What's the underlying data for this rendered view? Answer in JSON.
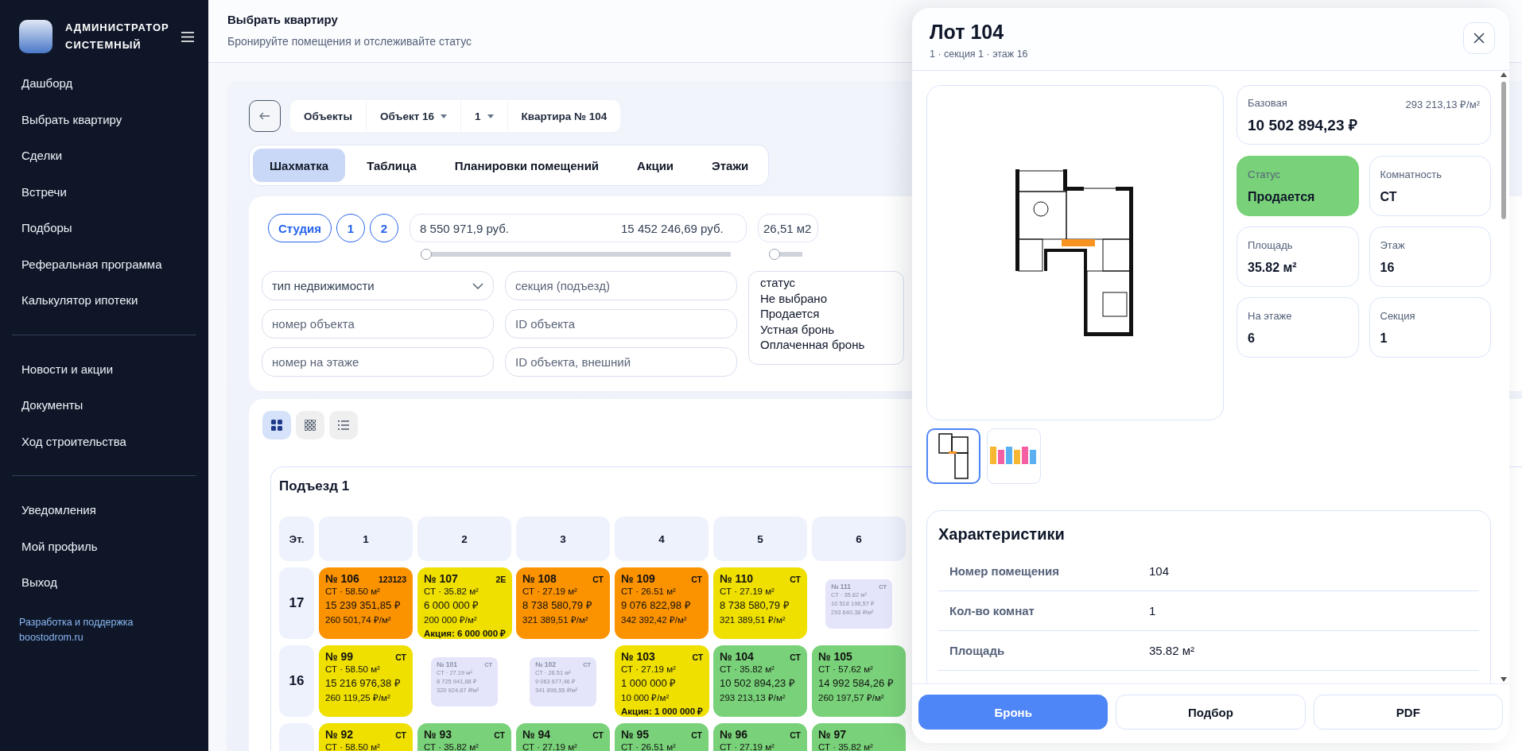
{
  "sidebar": {
    "user_name": "АДМИНИСТРАТОР СИСТЕМНЫЙ",
    "nav_groups": [
      [
        "Дашборд",
        "Выбрать квартиру",
        "Сделки",
        "Встречи",
        "Подборы",
        "Реферальная программа",
        "Калькулятор ипотеки"
      ],
      [
        "Новости и акции",
        "Документы",
        "Ход строительства"
      ],
      [
        "Уведомления",
        "Мой профиль",
        "Выход"
      ]
    ],
    "footer_link": "Разработка и поддержка boostodrom.ru"
  },
  "header": {
    "title": "Выбрать квартиру",
    "subtitle": "Бронируйте помещения и отслеживайте статус"
  },
  "breadcrumbs": [
    {
      "label": "Объекты",
      "dropdown": false
    },
    {
      "label": "Объект 16",
      "dropdown": true
    },
    {
      "label": "1",
      "dropdown": true
    },
    {
      "label": "Квартира № 104",
      "dropdown": false
    }
  ],
  "tabs": [
    {
      "label": "Шахматка",
      "selected": true
    },
    {
      "label": "Таблица",
      "selected": false
    },
    {
      "label": "Планировки помещений",
      "selected": false
    },
    {
      "label": "Акции",
      "selected": false
    },
    {
      "label": "Этажи",
      "selected": false
    }
  ],
  "filters": {
    "room_chips": [
      "Студия",
      "1",
      "2"
    ],
    "price_range": {
      "min": "8 550 971,9 руб.",
      "max": "15 452 246,69 руб.",
      "level": 0
    },
    "area_range": {
      "min": "26,51 м2",
      "level": 0
    },
    "field_columns": [
      [
        {
          "kind": "select",
          "placeholder": "тип недвижимости"
        },
        {
          "kind": "text",
          "placeholder": "номер объекта"
        },
        {
          "kind": "text",
          "placeholder": "номер на этаже"
        }
      ],
      [
        {
          "kind": "text",
          "placeholder": "секция (подъезд)"
        },
        {
          "kind": "text",
          "placeholder": "ID объекта"
        },
        {
          "kind": "text",
          "placeholder": "ID объекта, внешний"
        }
      ]
    ],
    "status_options": [
      "статус",
      "Не выбрано",
      "Продается",
      "Устная бронь",
      "Оплаченная бронь"
    ]
  },
  "view_modes": [
    {
      "kind": "tiles",
      "selected": true
    },
    {
      "kind": "grid",
      "selected": false
    },
    {
      "kind": "list",
      "selected": false
    }
  ],
  "section": {
    "title": "Подъезд 1",
    "floor_label": "Эт.",
    "columns": [
      "1",
      "2",
      "3",
      "4",
      "5",
      "6"
    ],
    "rows": [
      {
        "floor": "17",
        "cells": [
          {
            "kind": "lot",
            "color": "#fb9200",
            "number": "№ 106",
            "badge": "123123",
            "area": "СТ · 58.50 м²",
            "price": "15 239 351,85 ₽",
            "per_m2": "260 501,74 ₽/м²"
          },
          {
            "kind": "lot",
            "color": "#efe000",
            "number": "№ 107",
            "badge": "2Е",
            "area": "СТ · 35.82 м²",
            "price": "6 000 000 ₽",
            "per_m2": "200 000 ₽/м²",
            "promo": "Акция: 6 000 000 ₽"
          },
          {
            "kind": "lot",
            "color": "#fb9200",
            "number": "№ 108",
            "badge": "СТ",
            "area": "СТ · 27.19 м²",
            "price": "8 738 580,79 ₽",
            "per_m2": "321 389,51 ₽/м²"
          },
          {
            "kind": "lot",
            "color": "#fb9200",
            "number": "№ 109",
            "badge": "СТ",
            "area": "СТ · 26.51 м²",
            "price": "9 076 822,98 ₽",
            "per_m2": "342 392,42 ₽/м²"
          },
          {
            "kind": "lot",
            "color": "#efe000",
            "number": "№ 110",
            "badge": "СТ",
            "area": "СТ · 27.19 м²",
            "price": "8 738 580,79 ₽",
            "per_m2": "321 389,51 ₽/м²"
          },
          {
            "kind": "ghost",
            "color": "#e4e4fb",
            "number": "№ 111",
            "badge": "СТ",
            "area": "СТ · 35.82 м²",
            "price": "10 518 198,57 ₽",
            "per_m2": "293 640,38 ₽/м²"
          }
        ]
      },
      {
        "floor": "16",
        "cells": [
          {
            "kind": "lot",
            "color": "#efe000",
            "number": "№ 99",
            "badge": "СТ",
            "area": "СТ · 58.50 м²",
            "price": "15 216 976,38 ₽",
            "per_m2": "260 119,25 ₽/м²"
          },
          {
            "kind": "ghost",
            "color": "#e4e4fb",
            "number": "№ 101",
            "badge": "СТ",
            "area": "СТ · 27.19 м²",
            "price": "8 725 941,88 ₽",
            "per_m2": "320 924,67 ₽/м²"
          },
          {
            "kind": "ghost",
            "color": "#e4e4fb",
            "number": "№ 102",
            "badge": "СТ",
            "area": "СТ · 26.51 м²",
            "price": "9 063 677,46 ₽",
            "per_m2": "341 896,55 ₽/м²"
          },
          {
            "kind": "lot",
            "color": "#efe000",
            "number": "№ 103",
            "badge": "СТ",
            "area": "СТ · 27.19 м²",
            "price": "1 000 000 ₽",
            "per_m2": "10 000 ₽/м²",
            "promo": "Акция: 1 000 000 ₽"
          },
          {
            "kind": "lot",
            "color": "#79d279",
            "number": "№ 104",
            "badge": "СТ",
            "area": "СТ · 35.82 м²",
            "price": "10 502 894,23 ₽",
            "per_m2": "293 213,13 ₽/м²"
          },
          {
            "kind": "lot",
            "color": "#79d279",
            "number": "№ 105",
            "area": "СТ · 57.62 м²",
            "price": "14 992 584,26 ₽",
            "per_m2": "260 197,57 ₽/м²"
          }
        ]
      },
      {
        "cells": [
          {
            "kind": "lot",
            "color": "#efe000",
            "number": "№ 92",
            "badge": "СТ",
            "area": "СТ · 58.50 м²"
          },
          {
            "kind": "lot",
            "color": "#79d279",
            "number": "№ 93",
            "badge": "СТ",
            "area": "СТ · 35.82 м²"
          },
          {
            "kind": "lot",
            "color": "#79d279",
            "number": "№ 94",
            "badge": "СТ",
            "area": "СТ · 27.19 м²"
          },
          {
            "kind": "lot",
            "color": "#79d279",
            "number": "№ 95",
            "badge": "СТ",
            "area": "СТ · 26.51 м²"
          },
          {
            "kind": "lot",
            "color": "#79d279",
            "number": "№ 96",
            "badge": "СТ",
            "area": "СТ · 27.19 м²"
          },
          {
            "kind": "lot",
            "color": "#79d279",
            "number": "№ 97",
            "area": "СТ · 35.82 м²"
          }
        ]
      }
    ]
  },
  "lot_panel": {
    "title": "Лот 104",
    "subtitle": "1 · секция 1 · этаж 16",
    "price": {
      "label": "Базовая",
      "value": "10 502 894,23 ₽",
      "per_m2": "293 213,13 ₽/м²"
    },
    "stats": [
      {
        "label": "Статус",
        "value": "Продается",
        "color": "#79d279"
      },
      {
        "label": "Комнатность",
        "value": "СТ"
      },
      {
        "label": "Площадь",
        "value": "35.82 м²"
      },
      {
        "label": "Этаж",
        "value": "16"
      },
      {
        "label": "На этаже",
        "value": "6"
      },
      {
        "label": "Секция",
        "value": "1"
      }
    ],
    "thumbnails": [
      {
        "kind": "plan",
        "selected": true
      },
      {
        "kind": "facade",
        "selected": false
      }
    ],
    "characteristics": {
      "title": "Характеристики",
      "rows": [
        {
          "label": "Номер помещения",
          "value": "104"
        },
        {
          "label": "Кол-во комнат",
          "value": "1"
        },
        {
          "label": "Площадь",
          "value": "35.82 м²"
        }
      ]
    },
    "actions": [
      {
        "label": "Бронь",
        "primary": true
      },
      {
        "label": "Подбор",
        "primary": false
      },
      {
        "label": "PDF",
        "primary": false
      }
    ]
  }
}
